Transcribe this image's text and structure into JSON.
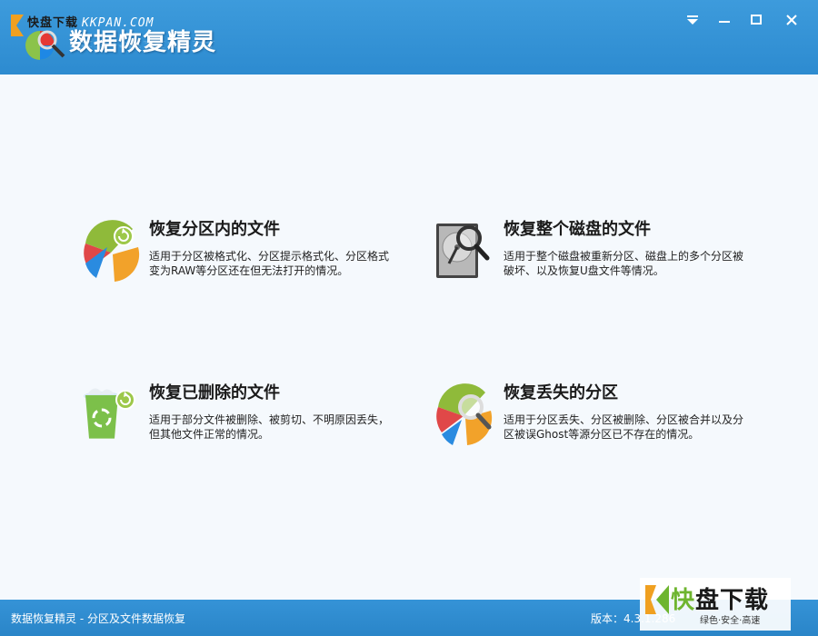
{
  "window": {
    "watermark": "快盘下载",
    "watermark_site": "KKPAN.COM",
    "app_title": "数据恢复精灵",
    "controls": {
      "menu": "dropdown-menu-icon",
      "minimize": "minimize-icon",
      "maximize": "maximize-icon",
      "close": "close-icon"
    }
  },
  "cards": [
    {
      "title": "恢复分区内的文件",
      "description": "适用于分区被格式化、分区提示格式化、分区格式变为RAW等分区还在但无法打开的情况。",
      "icon": "pie-chart-refresh-icon"
    },
    {
      "title": "恢复整个磁盘的文件",
      "description": "适用于整个磁盘被重新分区、磁盘上的多个分区被破坏、以及恢复U盘文件等情况。",
      "icon": "hard-disk-magnifier-icon"
    },
    {
      "title": "恢复已删除的文件",
      "description": "适用于部分文件被删除、被剪切、不明原因丢失，但其他文件正常的情况。",
      "icon": "recycle-bin-icon"
    },
    {
      "title": "恢复丢失的分区",
      "description": "适用于分区丢失、分区被删除、分区被合并以及分区被误Ghost等源分区已不存在的情况。",
      "icon": "pie-chart-magnifier-icon"
    }
  ],
  "status": {
    "text": "数据恢复精灵 - 分区及文件数据恢复",
    "version": "版本：4.3.1.286"
  },
  "badge": {
    "fast": "快",
    "rest": "盘下载",
    "slogan": "绿色·安全·高速"
  },
  "colors": {
    "titlebar": "#2d8bd0",
    "background": "#f5f9fd",
    "statusbar": "#2a85c8"
  }
}
